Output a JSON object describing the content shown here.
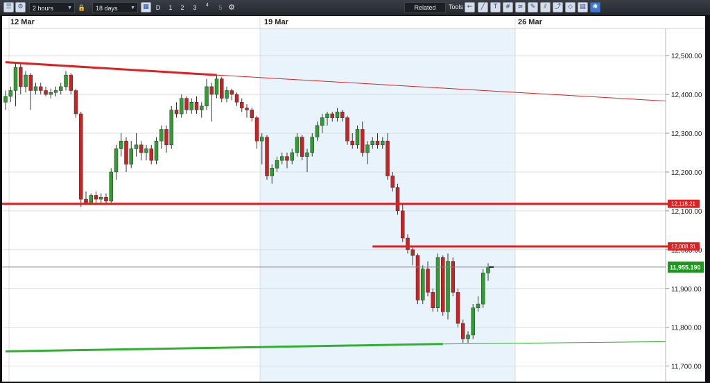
{
  "toolbar": {
    "interval": "2 hours",
    "range": "18 days",
    "periods": [
      "D",
      "1",
      "2",
      "3",
      "4",
      "5"
    ],
    "related_label": "Related",
    "tools_label": "Tools"
  },
  "colors": {
    "bull": "#2e9e2e",
    "bear": "#c82323",
    "resistance": "#e02020",
    "support": "#2fb02f",
    "weekband": "#e8f3fc"
  },
  "chart_data": {
    "type": "candlestick",
    "xlabels": [
      "12 Mar",
      "19 Mar",
      "26 Mar"
    ],
    "y_ticks": [
      "12,500.00",
      "12,400.00",
      "12,300.00",
      "12,200.00",
      "12,100.00",
      "12,000.00",
      "11,900.00",
      "11,800.00",
      "11,700.00"
    ],
    "ylim": [
      11660,
      12570
    ],
    "grid": true,
    "price_tags": [
      {
        "value": 12118.21,
        "label": "12,118.21",
        "color": "#e02020"
      },
      {
        "value": 12008.31,
        "label": "12,008.31",
        "color": "#e02020"
      },
      {
        "value": 11955.19,
        "label": "11,955.190",
        "color": "#1a9a1a"
      }
    ],
    "trendlines": [
      {
        "name": "resistance",
        "points": [
          [
            0,
            12483
          ],
          [
            42,
            12450
          ],
          [
            109,
            12390
          ]
        ]
      },
      {
        "name": "support",
        "points": [
          [
            0,
            11738
          ],
          [
            87,
            11757
          ],
          [
            109,
            11762
          ]
        ]
      }
    ],
    "hlines": [
      {
        "value": 12118.21,
        "from": 0
      },
      {
        "value": 12008.31,
        "from": 73
      }
    ],
    "last_price": 11955.19,
    "ohlc": [
      [
        12380,
        12410,
        12360,
        12395
      ],
      [
        12395,
        12420,
        12380,
        12410
      ],
      [
        12410,
        12480,
        12370,
        12470
      ],
      [
        12470,
        12480,
        12400,
        12420
      ],
      [
        12420,
        12460,
        12405,
        12450
      ],
      [
        12450,
        12455,
        12360,
        12410
      ],
      [
        12410,
        12430,
        12400,
        12420
      ],
      [
        12420,
        12430,
        12400,
        12410
      ],
      [
        12410,
        12420,
        12395,
        12400
      ],
      [
        12400,
        12415,
        12390,
        12405
      ],
      [
        12405,
        12420,
        12395,
        12410
      ],
      [
        12410,
        12430,
        12400,
        12420
      ],
      [
        12420,
        12460,
        12410,
        12450
      ],
      [
        12450,
        12455,
        12400,
        12410
      ],
      [
        12410,
        12415,
        12340,
        12350
      ],
      [
        12350,
        12355,
        12110,
        12130
      ],
      [
        12130,
        12150,
        12115,
        12120
      ],
      [
        12120,
        12145,
        12115,
        12140
      ],
      [
        12140,
        12150,
        12120,
        12130
      ],
      [
        12130,
        12145,
        12115,
        12135
      ],
      [
        12135,
        12145,
        12120,
        12125
      ],
      [
        12125,
        12210,
        12120,
        12200
      ],
      [
        12200,
        12270,
        12180,
        12260
      ],
      [
        12260,
        12300,
        12240,
        12280
      ],
      [
        12280,
        12290,
        12200,
        12220
      ],
      [
        12220,
        12280,
        12210,
        12260
      ],
      [
        12260,
        12300,
        12240,
        12270
      ],
      [
        12270,
        12280,
        12230,
        12250
      ],
      [
        12250,
        12270,
        12230,
        12260
      ],
      [
        12260,
        12270,
        12220,
        12230
      ],
      [
        12230,
        12290,
        12220,
        12280
      ],
      [
        12280,
        12320,
        12260,
        12310
      ],
      [
        12310,
        12320,
        12250,
        12270
      ],
      [
        12270,
        12370,
        12260,
        12360
      ],
      [
        12360,
        12380,
        12340,
        12350
      ],
      [
        12350,
        12400,
        12340,
        12390
      ],
      [
        12390,
        12395,
        12350,
        12360
      ],
      [
        12360,
        12390,
        12350,
        12380
      ],
      [
        12380,
        12395,
        12350,
        12360
      ],
      [
        12360,
        12380,
        12340,
        12370
      ],
      [
        12370,
        12440,
        12360,
        12420
      ],
      [
        12420,
        12430,
        12330,
        12400
      ],
      [
        12400,
        12450,
        12390,
        12440
      ],
      [
        12440,
        12445,
        12380,
        12390
      ],
      [
        12390,
        12420,
        12380,
        12410
      ],
      [
        12410,
        12415,
        12385,
        12400
      ],
      [
        12400,
        12405,
        12370,
        12380
      ],
      [
        12380,
        12390,
        12355,
        12365
      ],
      [
        12365,
        12375,
        12340,
        12360
      ],
      [
        12360,
        12365,
        12330,
        12340
      ],
      [
        12340,
        12345,
        12260,
        12280
      ],
      [
        12280,
        12300,
        12220,
        12290
      ],
      [
        12290,
        12295,
        12180,
        12190
      ],
      [
        12190,
        12220,
        12170,
        12210
      ],
      [
        12210,
        12240,
        12200,
        12230
      ],
      [
        12230,
        12250,
        12220,
        12240
      ],
      [
        12240,
        12250,
        12210,
        12230
      ],
      [
        12230,
        12260,
        12220,
        12250
      ],
      [
        12250,
        12300,
        12240,
        12290
      ],
      [
        12290,
        12295,
        12230,
        12240
      ],
      [
        12240,
        12260,
        12200,
        12250
      ],
      [
        12250,
        12300,
        12240,
        12290
      ],
      [
        12290,
        12330,
        12280,
        12320
      ],
      [
        12320,
        12350,
        12300,
        12340
      ],
      [
        12340,
        12355,
        12320,
        12350
      ],
      [
        12350,
        12355,
        12330,
        12340
      ],
      [
        12340,
        12365,
        12330,
        12355
      ],
      [
        12355,
        12360,
        12330,
        12340
      ],
      [
        12340,
        12345,
        12270,
        12280
      ],
      [
        12280,
        12300,
        12260,
        12270
      ],
      [
        12270,
        12320,
        12260,
        12310
      ],
      [
        12310,
        12330,
        12240,
        12250
      ],
      [
        12250,
        12280,
        12220,
        12270
      ],
      [
        12270,
        12290,
        12260,
        12280
      ],
      [
        12280,
        12300,
        12260,
        12270
      ],
      [
        12270,
        12290,
        12260,
        12280
      ],
      [
        12280,
        12300,
        12180,
        12190
      ],
      [
        12190,
        12200,
        12150,
        12160
      ],
      [
        12160,
        12170,
        12090,
        12100
      ],
      [
        12100,
        12120,
        12020,
        12030
      ],
      [
        12030,
        12040,
        11990,
        12000
      ],
      [
        12000,
        12010,
        11960,
        11985
      ],
      [
        11985,
        11990,
        11860,
        11870
      ],
      [
        11870,
        11960,
        11860,
        11950
      ],
      [
        11950,
        11970,
        11880,
        11890
      ],
      [
        11890,
        11900,
        11840,
        11850
      ],
      [
        11850,
        11990,
        11840,
        11980
      ],
      [
        11980,
        11985,
        11830,
        11840
      ],
      [
        11840,
        11990,
        11820,
        11970
      ],
      [
        11970,
        11980,
        11880,
        11890
      ],
      [
        11890,
        11900,
        11800,
        11810
      ],
      [
        11810,
        11820,
        11760,
        11770
      ],
      [
        11770,
        11790,
        11760,
        11780
      ],
      [
        11780,
        11860,
        11770,
        11850
      ],
      [
        11850,
        11880,
        11840,
        11860
      ],
      [
        11860,
        11950,
        11850,
        11940
      ],
      [
        11940,
        11965,
        11920,
        11955
      ]
    ]
  }
}
